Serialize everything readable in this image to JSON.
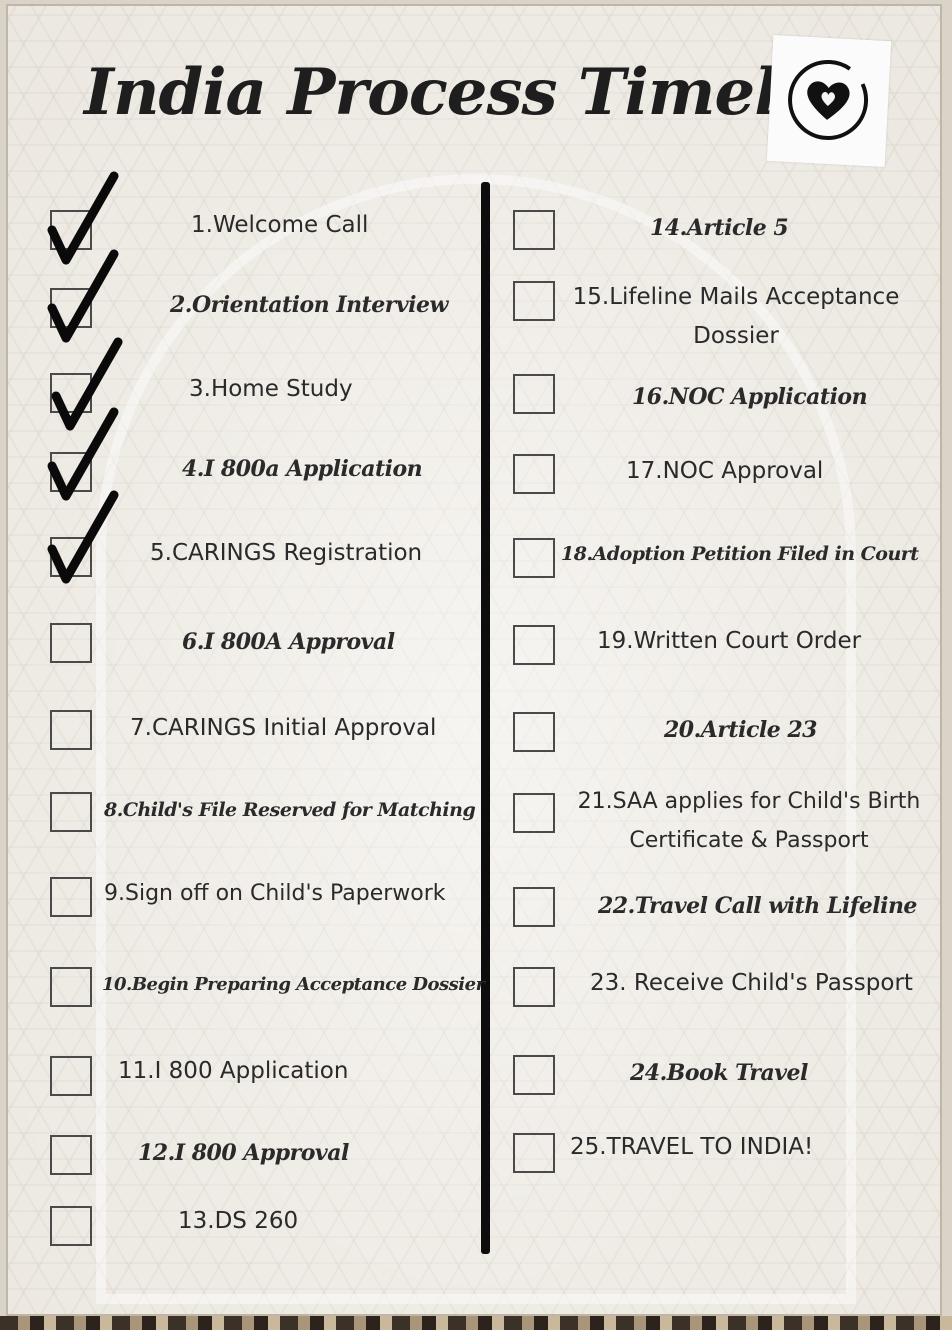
{
  "title": "India Process Timeline",
  "icons": {
    "badge": "heart-icon",
    "check": "checkmark-icon"
  },
  "colors": {
    "ink": "#1e1e1e",
    "divider": "#0d0d0d",
    "background": "#ece8e1"
  },
  "steps_left": [
    {
      "label": "1.Welcome Call",
      "checked": true
    },
    {
      "label": "2.Orientation Interview",
      "checked": true
    },
    {
      "label": "3.Home Study",
      "checked": true
    },
    {
      "label": "4.I 800a Application",
      "checked": true
    },
    {
      "label": "5.CARINGS Registration",
      "checked": true
    },
    {
      "label": "6.I 800A Approval",
      "checked": false
    },
    {
      "label": "7.CARINGS Initial Approval",
      "checked": false
    },
    {
      "label": "8.Child's File Reserved for Matching",
      "checked": false
    },
    {
      "label": "9.Sign off on Child's Paperwork",
      "checked": false
    },
    {
      "label": "10.Begin Preparing Acceptance Dossier",
      "checked": false
    },
    {
      "label": "11.I 800 Application",
      "checked": false
    },
    {
      "label": "12.I 800 Approval",
      "checked": false
    },
    {
      "label": "13.DS 260",
      "checked": false
    }
  ],
  "steps_right": [
    {
      "label": "14.Article 5",
      "checked": false
    },
    {
      "label": "15.Lifeline Mails Acceptance Dossier",
      "checked": false
    },
    {
      "label": "16.NOC Application",
      "checked": false
    },
    {
      "label": "17.NOC Approval",
      "checked": false
    },
    {
      "label": "18.Adoption Petition Filed in Court",
      "checked": false
    },
    {
      "label": "19.Written Court Order",
      "checked": false
    },
    {
      "label": "20.Article 23",
      "checked": false
    },
    {
      "label": "21.SAA applies for Child's Birth Certificate & Passport",
      "checked": false
    },
    {
      "label": "22.Travel Call with Lifeline",
      "checked": false
    },
    {
      "label": "23. Receive Child's Passport",
      "checked": false
    },
    {
      "label": "24.Book Travel",
      "checked": false
    },
    {
      "label": "25.TRAVEL TO INDIA!",
      "checked": false
    }
  ]
}
